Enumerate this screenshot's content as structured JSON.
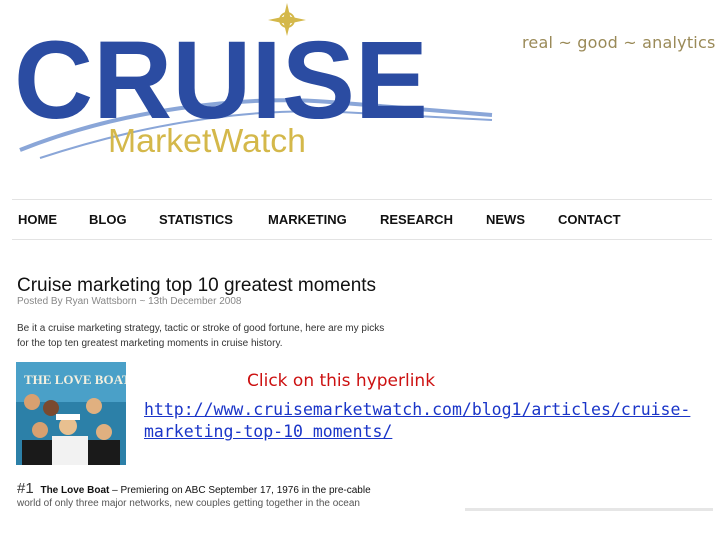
{
  "brand": {
    "logo_word": "CRUISE",
    "logo_sub": "MarketWatch",
    "tagline": "real ~ good ~ analytics",
    "colors": {
      "blue": "#2b4ca2",
      "gold": "#d4b84a",
      "light_blue": "#8aa6d8"
    }
  },
  "nav": {
    "items": [
      "HOME",
      "BLOG",
      "STATISTICS",
      "MARKETING",
      "RESEARCH",
      "NEWS",
      "CONTACT"
    ]
  },
  "article": {
    "title": "Cruise marketing top 10 greatest moments",
    "byline": "Posted By Ryan Wattsborn ~ 13th December 2008",
    "intro": "Be it a cruise marketing strategy, tactic or stroke of good fortune, here are my picks for the top ten greatest marketing moments in cruise history.",
    "thumbnail_label": "THE LOVE BOAT",
    "item_number": "#1",
    "item_title": "The Love Boat",
    "item_text": "– Premiering on ABC September 17, 1976 in the pre-cable",
    "item_text_2": "world of only three major networks, new couples getting together in the ocean"
  },
  "overlay": {
    "instruction": "Click on this hyperlink",
    "url": "http://www.cruisemarketwatch.com/blog1/articles/cruise-marketing-top-10 moments/"
  }
}
